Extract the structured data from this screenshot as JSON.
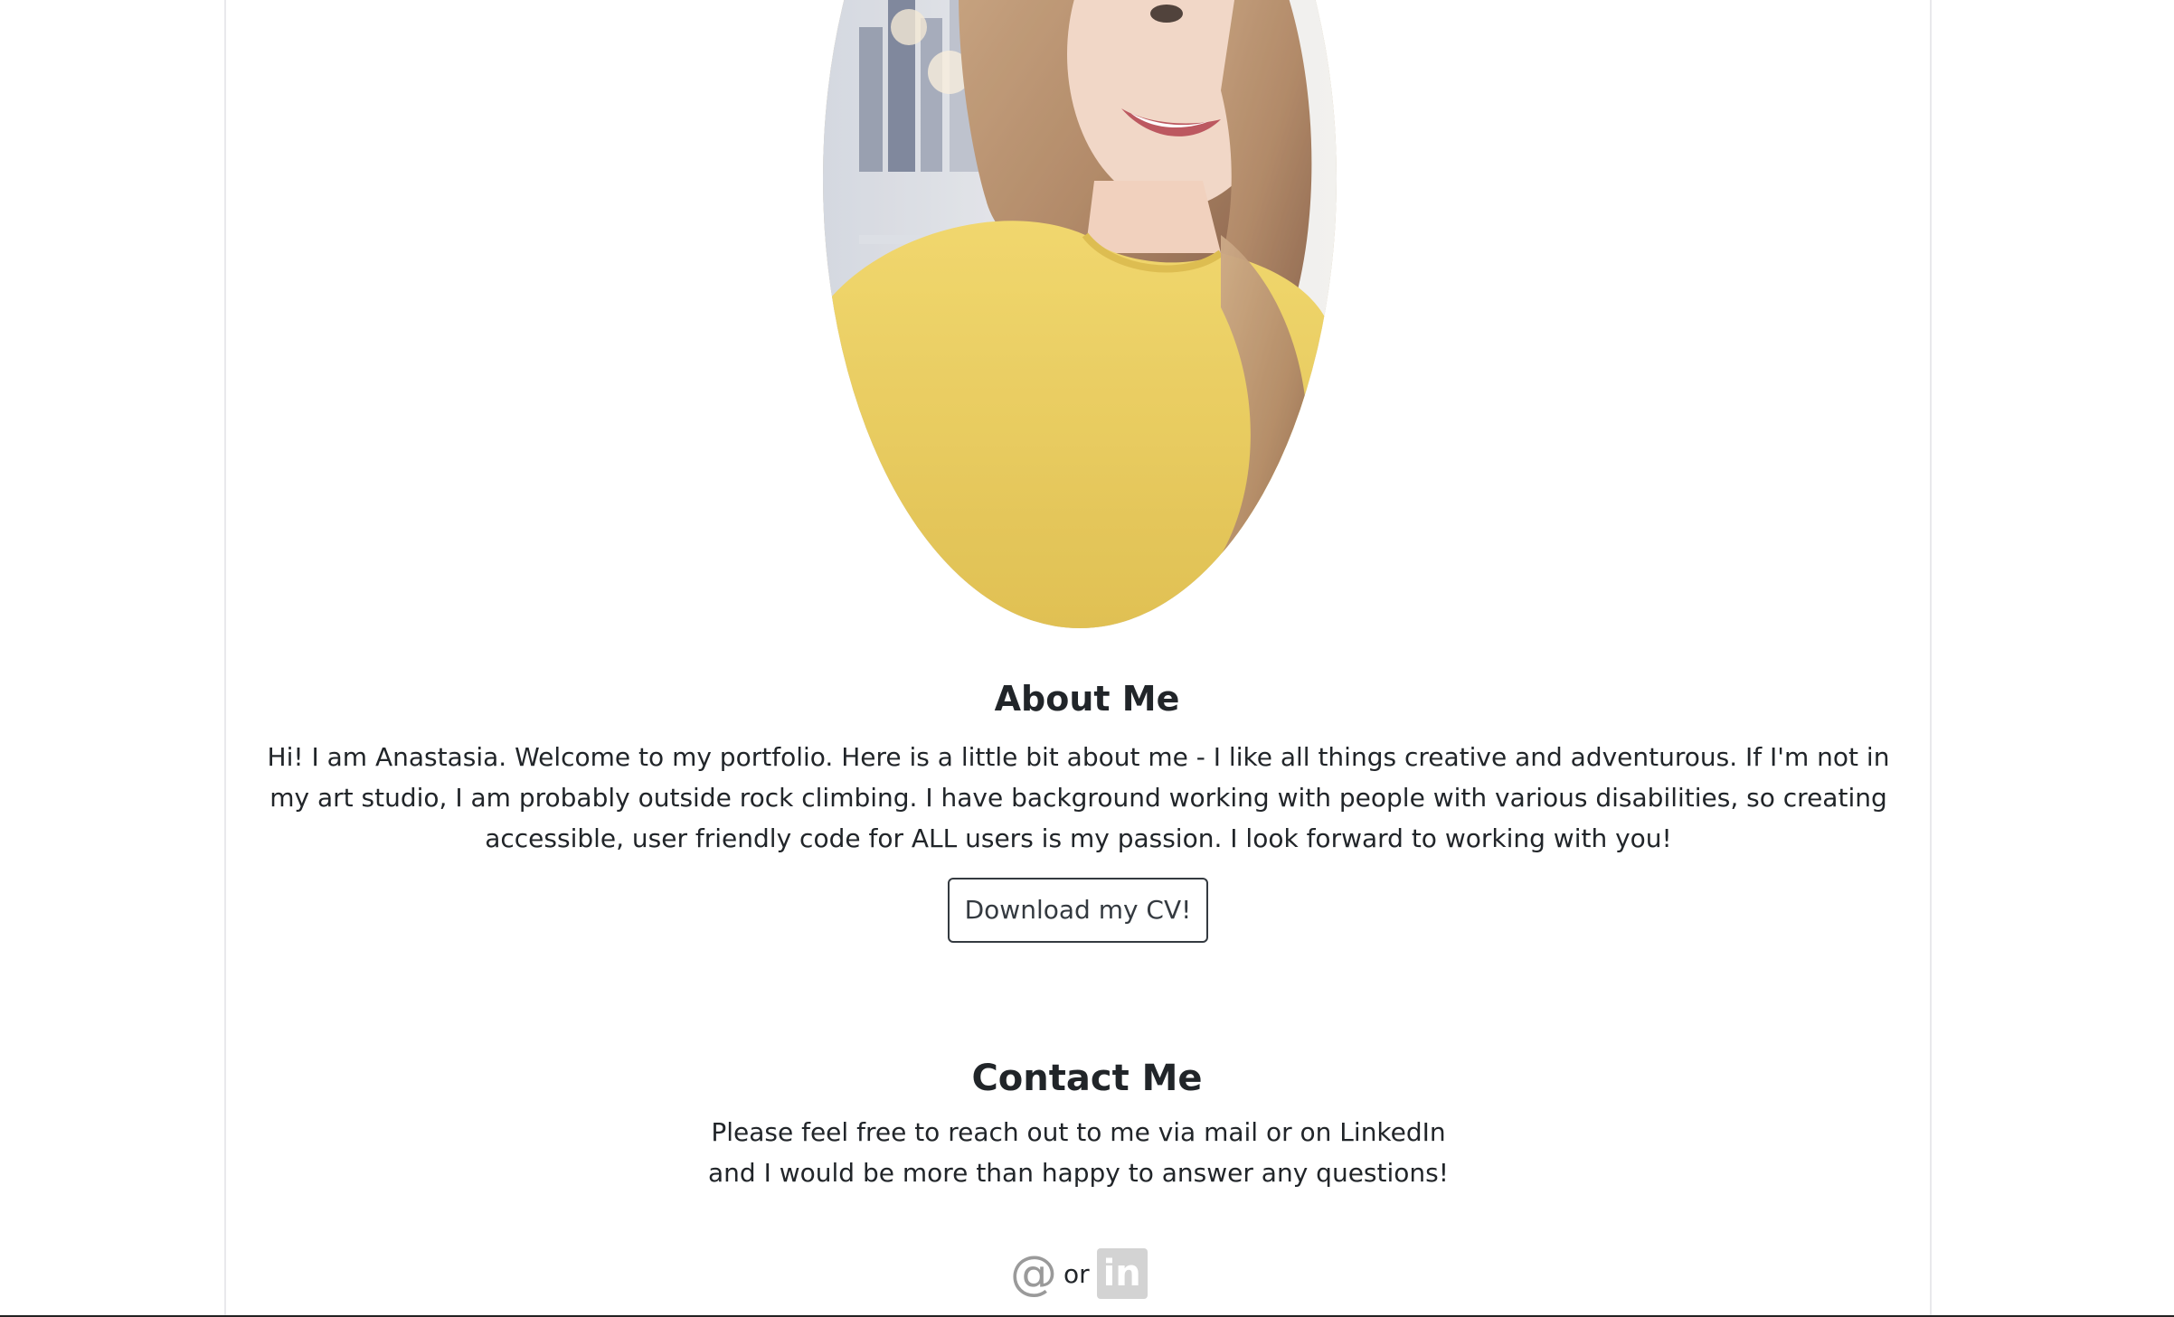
{
  "profile": {
    "photo_icon": "portrait-photo"
  },
  "about": {
    "title": "About Me",
    "text": "Hi! I am Anastasia. Welcome to my portfolio. Here is a little bit about me - I like all things creative and adventurous. If I'm not in my art studio, I am probably outside rock climbing. I have background working with people with various disabilities, so creating accessible, user friendly code for ALL users is my passion. I look forward to working with you!",
    "cv_button_label": "Download my CV!"
  },
  "contact": {
    "title": "Contact Me",
    "text": "Please feel free to reach out to me via mail or on LinkedIn and I would be more than happy to answer any questions!",
    "mail_icon": "at-icon",
    "mail_glyph": "@",
    "separator": "or",
    "linkedin_icon": "linkedin-icon",
    "linkedin_glyph": "in"
  },
  "colors": {
    "text": "#212529",
    "button_border": "#343a40",
    "icon_gray": "#9a9a9a",
    "linkedin_bg": "#d3d3d3",
    "sweater_yellow": "#e9c84a"
  }
}
